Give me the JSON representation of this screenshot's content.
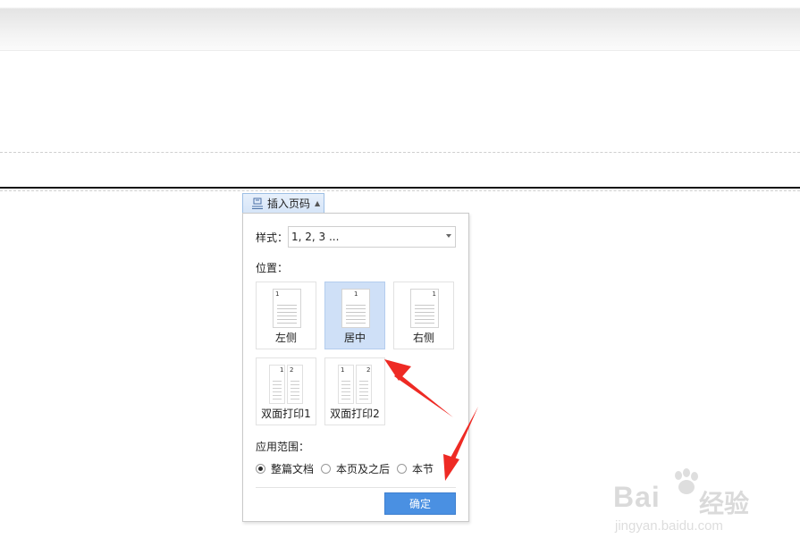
{
  "toolbar": {
    "insert_tab_label": "插入页码",
    "icon": "page-number-icon"
  },
  "panel": {
    "style_label": "样式：",
    "style_value": "1, 2, 3 ...",
    "position_label": "位置：",
    "tiles": [
      {
        "label": "左侧",
        "nums": [
          "1"
        ]
      },
      {
        "label": "居中",
        "nums": [
          "1"
        ],
        "selected": true
      },
      {
        "label": "右侧",
        "nums": [
          "1"
        ]
      },
      {
        "label": "双面打印1",
        "nums": [
          "1",
          "2"
        ]
      },
      {
        "label": "双面打印2",
        "nums": [
          "1",
          "2"
        ]
      }
    ],
    "scope_label": "应用范围：",
    "scope_options": [
      {
        "label": "整篇文档",
        "checked": true
      },
      {
        "label": "本页及之后",
        "checked": false
      },
      {
        "label": "本节",
        "checked": false
      }
    ],
    "ok_label": "确定"
  },
  "watermark": {
    "brand": "Bai",
    "brand_cn": "经验",
    "url": "jingyan.baidu.com"
  },
  "colors": {
    "accent": "#4a90e2",
    "selected_tile": "#cfe0f7",
    "arrow": "#ee2a24"
  }
}
